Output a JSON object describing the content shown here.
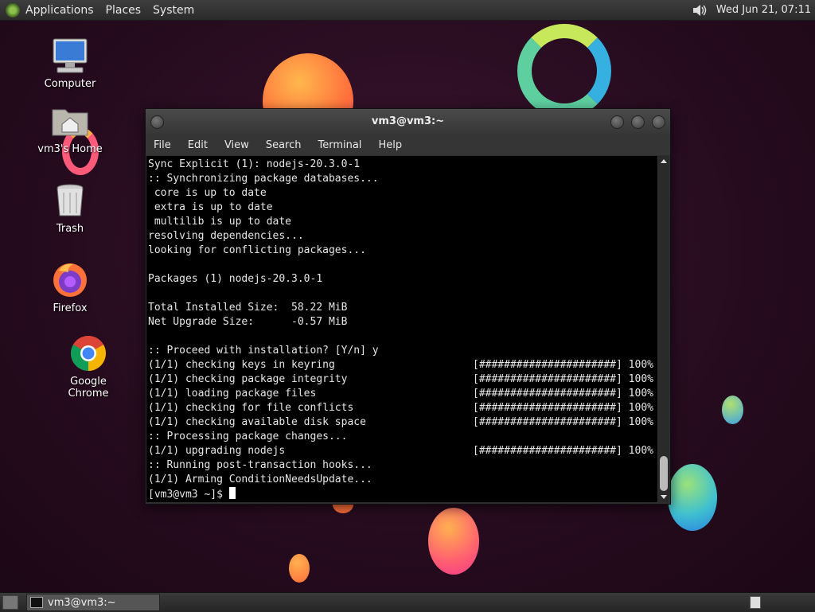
{
  "top_panel": {
    "menus": [
      "Applications",
      "Places",
      "System"
    ],
    "clock": "Wed Jun 21, 07:11"
  },
  "desktop": {
    "icons": [
      {
        "label": "Computer",
        "icon": "computer-icon"
      },
      {
        "label": "vm3's Home",
        "icon": "home-folder-icon"
      },
      {
        "label": "Trash",
        "icon": "trash-icon"
      },
      {
        "label": "Firefox",
        "icon": "firefox-icon"
      },
      {
        "label": "Google Chrome",
        "icon": "chrome-icon"
      }
    ]
  },
  "terminal": {
    "title": "vm3@vm3:~",
    "menu": [
      "File",
      "Edit",
      "View",
      "Search",
      "Terminal",
      "Help"
    ],
    "lines": [
      {
        "text": "Sync Explicit (1): nodejs-20.3.0-1"
      },
      {
        "text": ":: Synchronizing package databases..."
      },
      {
        "text": " core is up to date"
      },
      {
        "text": " extra is up to date"
      },
      {
        "text": " multilib is up to date"
      },
      {
        "text": "resolving dependencies..."
      },
      {
        "text": "looking for conflicting packages..."
      },
      {
        "text": ""
      },
      {
        "text": "Packages (1) nodejs-20.3.0-1"
      },
      {
        "text": ""
      },
      {
        "text": "Total Installed Size:  58.22 MiB"
      },
      {
        "text": "Net Upgrade Size:      -0.57 MiB"
      },
      {
        "text": ""
      },
      {
        "text": ":: Proceed with installation? [Y/n] y"
      },
      {
        "text": "(1/1) checking keys in keyring",
        "progress": "[######################] 100%"
      },
      {
        "text": "(1/1) checking package integrity",
        "progress": "[######################] 100%"
      },
      {
        "text": "(1/1) loading package files",
        "progress": "[######################] 100%"
      },
      {
        "text": "(1/1) checking for file conflicts",
        "progress": "[######################] 100%"
      },
      {
        "text": "(1/1) checking available disk space",
        "progress": "[######################] 100%"
      },
      {
        "text": ":: Processing package changes..."
      },
      {
        "text": "(1/1) upgrading nodejs",
        "progress": "[######################] 100%"
      },
      {
        "text": ":: Running post-transaction hooks..."
      },
      {
        "text": "(1/1) Arming ConditionNeedsUpdate..."
      }
    ],
    "prompt": "[vm3@vm3 ~]$ "
  },
  "taskbar": {
    "window_button": "vm3@vm3:~"
  }
}
